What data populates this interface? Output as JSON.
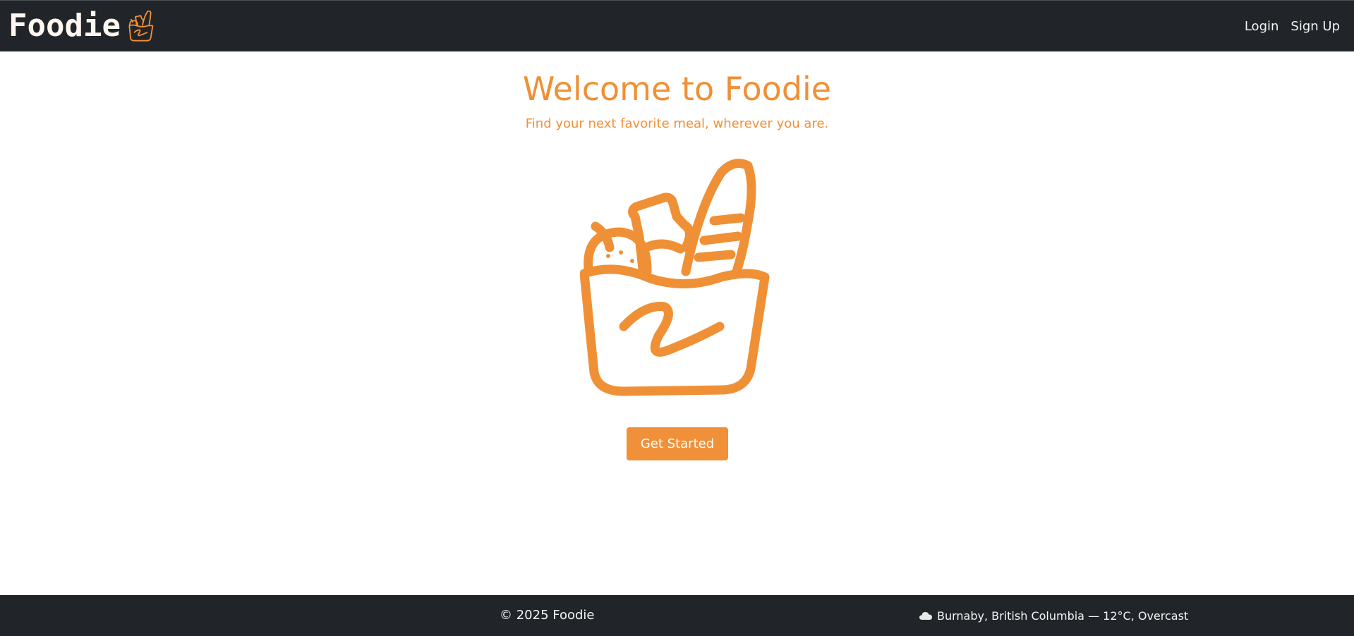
{
  "header": {
    "brand_name": "Foodie",
    "brand_icon": "grocery-bag-icon",
    "nav": {
      "login": "Login",
      "signup": "Sign Up"
    }
  },
  "hero": {
    "title": "Welcome to Foodie",
    "subtitle": "Find your next favorite meal, wherever you are.",
    "illustration": "grocery-bag-icon",
    "cta_label": "Get Started"
  },
  "footer": {
    "copyright": "© 2025 Foodie",
    "weather": {
      "icon": "cloud-icon",
      "text": "Burnaby, British Columbia — 12°C, Overcast"
    }
  },
  "colors": {
    "accent": "#f0913a",
    "navbar": "#212529",
    "background": "#ffffff"
  }
}
